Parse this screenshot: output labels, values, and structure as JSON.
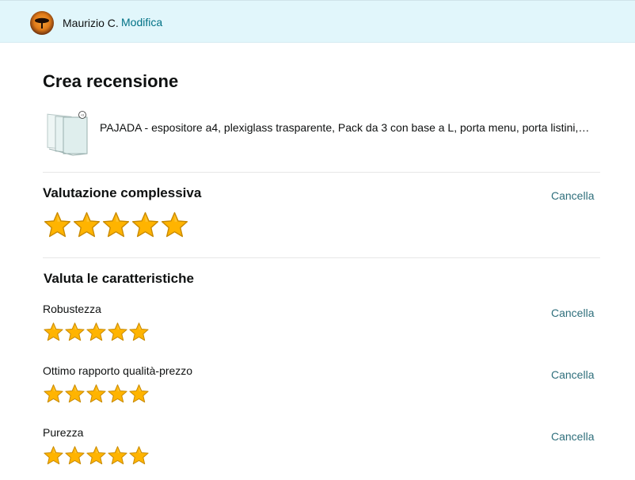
{
  "header": {
    "user_name": "Maurizio C.",
    "edit_label": "Modifica",
    "background": "#e1f6fb"
  },
  "page": {
    "title": "Crea recensione"
  },
  "product": {
    "title": "PAJADA - espositore a4, plexiglass trasparente, Pack da 3 con base a L, porta menu, porta listini,…"
  },
  "overall": {
    "title": "Valutazione complessiva",
    "clear_label": "Cancella",
    "rating": 5,
    "max": 5
  },
  "features": {
    "title": "Valuta le caratteristiche",
    "items": [
      {
        "label": "Robustezza",
        "clear_label": "Cancella",
        "rating": 5,
        "max": 5
      },
      {
        "label": "Ottimo rapporto qualità-prezzo",
        "clear_label": "Cancella",
        "rating": 5,
        "max": 5
      },
      {
        "label": "Purezza",
        "clear_label": "Cancella",
        "rating": 5,
        "max": 5
      }
    ]
  },
  "colors": {
    "star_fill": "#ffb400",
    "link": "#007185"
  }
}
